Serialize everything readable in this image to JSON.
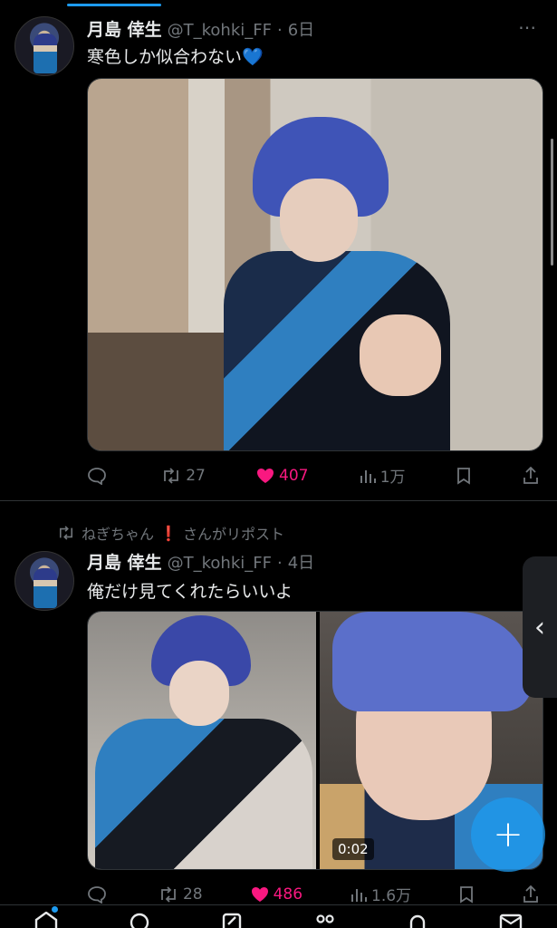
{
  "tweets": [
    {
      "name": "月島 倖生",
      "handle": "@T_kohki_FF",
      "separator": "·",
      "time": "6日",
      "text": "寒色しか似合わない",
      "emoji": "💙",
      "stats": {
        "replies": "",
        "reposts": "27",
        "likes": "407",
        "views": "1万"
      }
    },
    {
      "repost_by": "ねぎちゃん",
      "repost_bang": "❗",
      "repost_suffix": "さんがリポスト",
      "name": "月島 倖生",
      "handle": "@T_kohki_FF",
      "separator": "·",
      "time": "4日",
      "text": "俺だけ見てくれたらいいよ",
      "video_time": "0:02",
      "stats": {
        "replies": "",
        "reposts": "28",
        "likes": "486",
        "views": "1.6万"
      }
    }
  ],
  "more_label": "⋯",
  "side_handle_label": "‹",
  "fab_label": "+",
  "colors": {
    "accent": "#1d9bf0",
    "like": "#f91880",
    "muted": "#71767b"
  },
  "icons": [
    "reply-icon",
    "repost-icon",
    "heart-icon",
    "views-icon",
    "bookmark-icon",
    "share-icon",
    "home-icon",
    "search-icon",
    "grok-icon",
    "communities-icon",
    "notifications-icon",
    "messages-icon"
  ]
}
